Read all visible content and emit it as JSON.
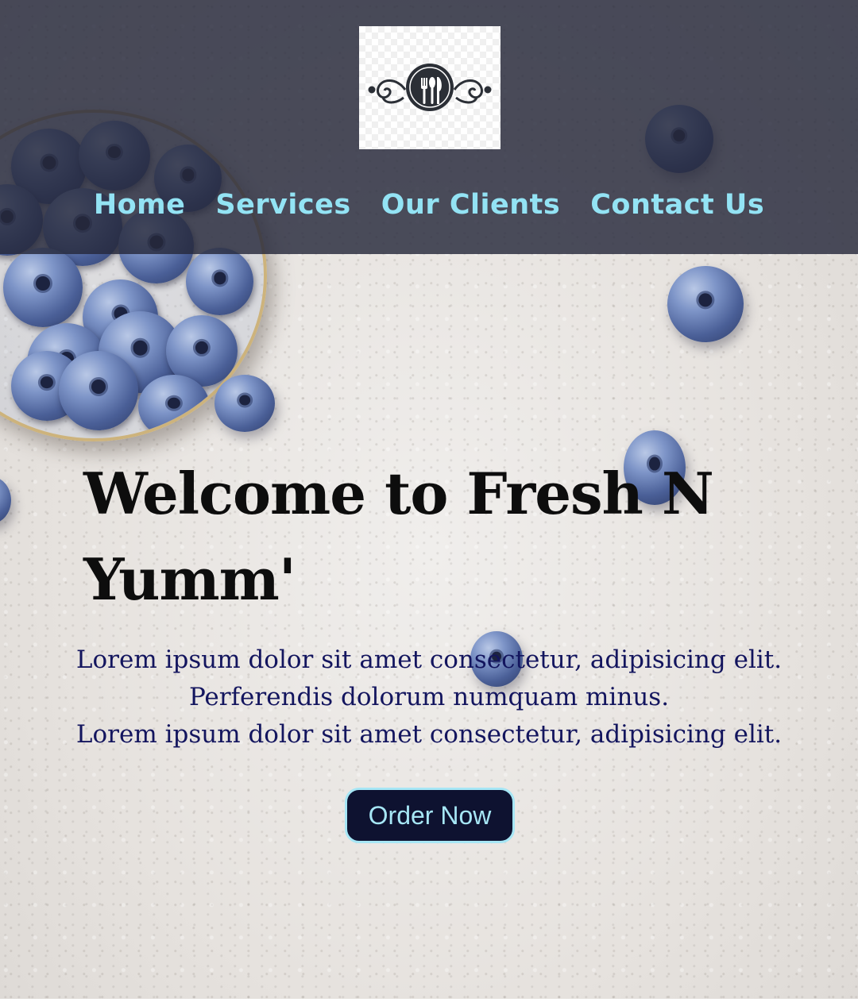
{
  "brand": {
    "logo_icon": "cutlery-emblem-icon"
  },
  "nav": {
    "items": [
      {
        "label": "Home"
      },
      {
        "label": "Services"
      },
      {
        "label": "Our Clients"
      },
      {
        "label": "Contact Us"
      }
    ],
    "link_color": "#93e3f4",
    "background": "#26283a"
  },
  "hero": {
    "title": "Welcome to Fresh N Yumm'",
    "lines": [
      "Lorem ipsum dolor sit amet consectetur, adipisicing elit.",
      "Perferendis dolorum numquam minus.",
      "Lorem ipsum dolor sit amet consectetur, adipisicing elit."
    ],
    "cta_label": "Order Now",
    "text_color": "#13155e",
    "cta_background": "#0e1230",
    "cta_border": "#a6e6f5"
  }
}
